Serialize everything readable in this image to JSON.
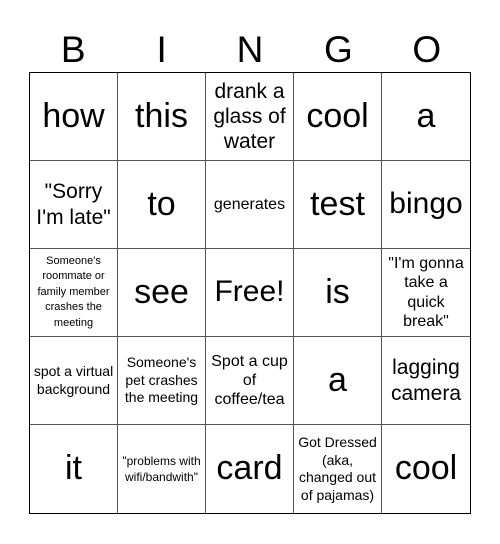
{
  "header": {
    "letters": [
      "B",
      "I",
      "N",
      "G",
      "O"
    ]
  },
  "cells": [
    {
      "text": "how",
      "size": "xl"
    },
    {
      "text": "this",
      "size": "xl"
    },
    {
      "text": "drank a glass of water",
      "size": "md"
    },
    {
      "text": "cool",
      "size": "xl"
    },
    {
      "text": "a",
      "size": "xl"
    },
    {
      "text": "\"Sorry I'm late\"",
      "size": "md"
    },
    {
      "text": "to",
      "size": "xl"
    },
    {
      "text": "generates",
      "size": "sm"
    },
    {
      "text": "test",
      "size": "xl"
    },
    {
      "text": "bingo",
      "size": "lg"
    },
    {
      "text": "Someone's roommate or family member crashes the meeting",
      "size": "tiny"
    },
    {
      "text": "see",
      "size": "xl"
    },
    {
      "text": "Free!",
      "size": "lg"
    },
    {
      "text": "is",
      "size": "xl"
    },
    {
      "text": "\"I'm gonna take a quick break\"",
      "size": "sm"
    },
    {
      "text": "spot a virtual background",
      "size": "xs"
    },
    {
      "text": "Someone's pet crashes the meeting",
      "size": "xs"
    },
    {
      "text": "Spot a cup of coffee/tea",
      "size": "sm"
    },
    {
      "text": "a",
      "size": "xl"
    },
    {
      "text": "lagging camera",
      "size": "md"
    },
    {
      "text": "it",
      "size": "xl"
    },
    {
      "text": "\"problems with wifi/bandwith\"",
      "size": "xxs"
    },
    {
      "text": "card",
      "size": "xl"
    },
    {
      "text": "Got Dressed (aka, changed out of pajamas)",
      "size": "xs"
    },
    {
      "text": "cool",
      "size": "xl"
    }
  ]
}
